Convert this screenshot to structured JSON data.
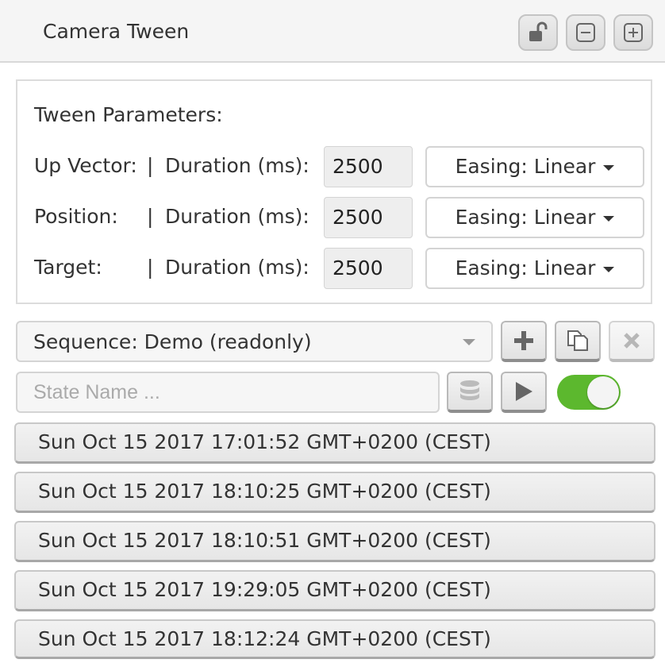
{
  "window": {
    "title": "Camera Tween",
    "buttons": [
      {
        "icon": "unlock-icon"
      },
      {
        "icon": "collapse-icon"
      },
      {
        "icon": "expand-icon"
      }
    ]
  },
  "tween_parameters": {
    "heading": "Tween Parameters:",
    "rows": [
      {
        "label": "Up Vector:",
        "separator": "|",
        "duration_label": "Duration (ms):",
        "duration": "2500",
        "easing": "Easing: Linear"
      },
      {
        "label": "Position:",
        "separator": "|",
        "duration_label": "Duration (ms):",
        "duration": "2500",
        "easing": "Easing: Linear"
      },
      {
        "label": "Target:",
        "separator": "|",
        "duration_label": "Duration (ms):",
        "duration": "2500",
        "easing": "Easing: Linear"
      }
    ]
  },
  "sequence": {
    "selected": "Sequence: Demo (readonly)",
    "buttons": [
      {
        "icon": "plus-icon"
      },
      {
        "icon": "copy-icon"
      },
      {
        "icon": "delete-icon"
      }
    ]
  },
  "state": {
    "name_value": "",
    "name_placeholder": "State Name ...",
    "toggle_on": true,
    "toggle_color": "#5cb82e"
  },
  "states": [
    "Sun Oct 15 2017 17:01:52 GMT+0200 (CEST)",
    "Sun Oct 15 2017 18:10:25 GMT+0200 (CEST)",
    "Sun Oct 15 2017 18:10:51 GMT+0200 (CEST)",
    "Sun Oct 15 2017 19:29:05 GMT+0200 (CEST)",
    "Sun Oct 15 2017 18:12:24 GMT+0200 (CEST)"
  ]
}
